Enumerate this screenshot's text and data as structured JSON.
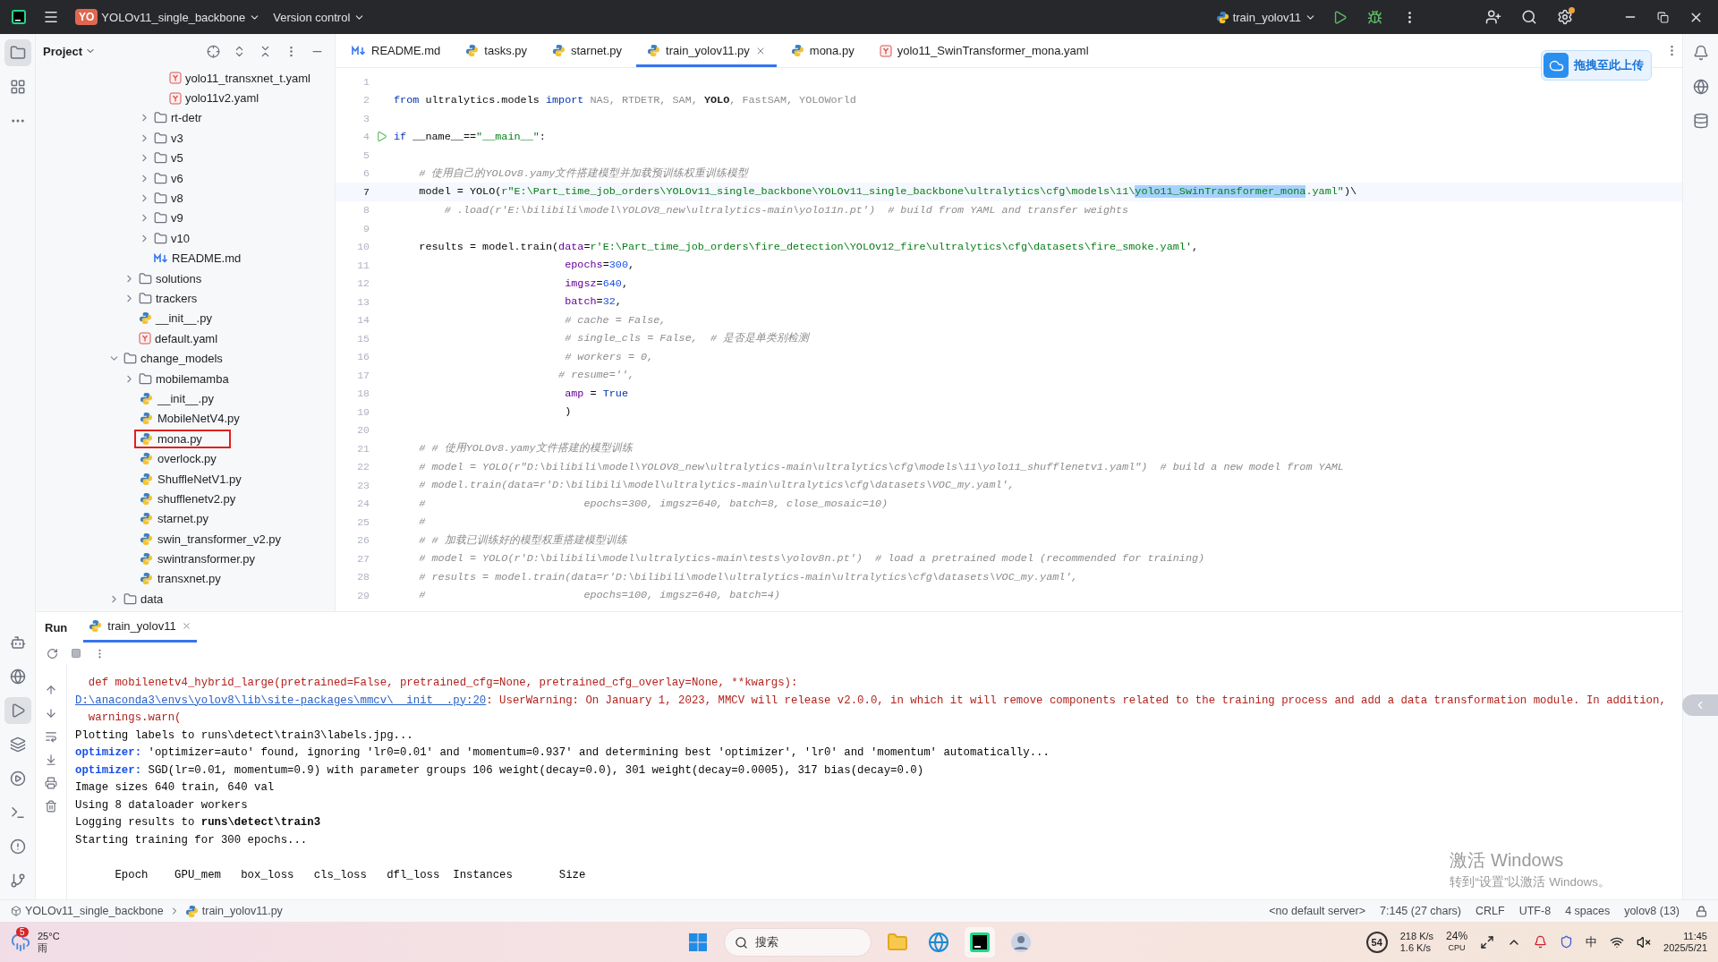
{
  "title_bar": {
    "project_badge": "YO",
    "project": "YOLOv11_single_backbone",
    "vcs": "Version control",
    "run_config": "train_yolov11"
  },
  "project": {
    "title": "Project",
    "tree": [
      {
        "children": [
          {
            "children": [
              {
                "children": [
                  {
                    "label": "yolo11_transxnet_t.yaml",
                    "kind": "yaml"
                  },
                  {
                    "label": "yolo11v2.yaml",
                    "kind": "yaml"
                  }
                ]
              },
              {
                "label": "rt-detr",
                "kind": "folder",
                "expanded": false
              },
              {
                "label": "v3",
                "kind": "folder",
                "expanded": false
              },
              {
                "label": "v5",
                "kind": "folder",
                "expanded": false
              },
              {
                "label": "v6",
                "kind": "folder",
                "expanded": false
              },
              {
                "label": "v8",
                "kind": "folder",
                "expanded": false
              },
              {
                "label": "v9",
                "kind": "folder",
                "expanded": false
              },
              {
                "label": "v10",
                "kind": "folder",
                "expanded": false
              },
              {
                "label": "README.md",
                "kind": "md"
              }
            ]
          },
          {
            "label": "solutions",
            "kind": "folder",
            "expanded": false
          },
          {
            "label": "trackers",
            "kind": "folder",
            "expanded": false
          },
          {
            "label": "__init__.py",
            "kind": "py"
          },
          {
            "label": "default.yaml",
            "kind": "yaml"
          }
        ]
      },
      {
        "label": "change_models",
        "kind": "folder",
        "expanded": true,
        "children": [
          {
            "label": "mobilemamba",
            "kind": "folder",
            "expanded": false
          },
          {
            "label": "__init__.py",
            "kind": "py",
            "annotated": false
          },
          {
            "label": "MobileNetV4.py",
            "kind": "py",
            "annotated": false
          },
          {
            "label": "mona.py",
            "kind": "py",
            "annotated": true
          },
          {
            "label": "overlock.py",
            "kind": "py",
            "annotated": false
          },
          {
            "label": "ShuffleNetV1.py",
            "kind": "py",
            "annotated": false
          },
          {
            "label": "shufflenetv2.py",
            "kind": "py",
            "annotated": false
          },
          {
            "label": "starnet.py",
            "kind": "py",
            "annotated": false
          },
          {
            "label": "swin_transformer_v2.py",
            "kind": "py",
            "annotated": false
          },
          {
            "label": "swintransformer.py",
            "kind": "py",
            "annotated": false
          },
          {
            "label": "transxnet.py",
            "kind": "py",
            "annotated": false
          }
        ]
      },
      {
        "label": "data",
        "kind": "folder",
        "expanded": false
      }
    ]
  },
  "editor_tabs": [
    {
      "label": "README.md",
      "kind": "md",
      "selected": false
    },
    {
      "label": "tasks.py",
      "kind": "py",
      "selected": false
    },
    {
      "label": "starnet.py",
      "kind": "py",
      "selected": false
    },
    {
      "label": "train_yolov11.py",
      "kind": "py",
      "selected": true
    },
    {
      "label": "mona.py",
      "kind": "py",
      "selected": false
    },
    {
      "label": "yolo11_SwinTransformer_mona.yaml",
      "kind": "yaml",
      "selected": false
    }
  ],
  "upload_widget": {
    "label": "拖拽至此上传"
  },
  "code": [
    {
      "n": "1",
      "current": false
    },
    {
      "n": "2",
      "current": false,
      "segments": [
        {
          "kind": "kw",
          "text": "from"
        },
        {
          "kind": "plain",
          "text": " ultralytics.models "
        },
        {
          "kind": "kw",
          "text": "import"
        },
        {
          "kind": "dim",
          "text": " NAS, RTDETR, SAM, "
        },
        {
          "kind": "bold",
          "text": "YOLO"
        },
        {
          "kind": "dim",
          "text": ", FastSAM, YOLOWorld"
        }
      ]
    },
    {
      "n": "3",
      "current": false
    },
    {
      "n": "4",
      "current": false,
      "run_marker": true,
      "segments": [
        {
          "kind": "kw",
          "text": "if"
        },
        {
          "kind": "plain",
          "text": " __name__=="
        },
        {
          "kind": "str",
          "text": "\"__main__\""
        },
        {
          "kind": "plain",
          "text": ":"
        }
      ]
    },
    {
      "n": "5",
      "current": false
    },
    {
      "n": "6",
      "current": false,
      "segments": [
        {
          "kind": "comment",
          "text": "    # 使用自己的YOLOv8.yamy文件搭建模型并加载预训练权重训练模型"
        }
      ]
    },
    {
      "n": "7",
      "current": true,
      "segments": [
        {
          "kind": "plain",
          "text": "    model = YOLO("
        },
        {
          "kind": "str",
          "text": "r\"E:\\Part_time_job_orders\\YOLOv11_single_backbone\\YOLOv11_single_backbone\\ultralytics\\cfg\\models\\11\\"
        },
        {
          "kind": "sel",
          "text": "yolo11_SwinTransformer_mona"
        },
        {
          "kind": "str",
          "text": ".yaml\""
        },
        {
          "kind": "plain",
          "text": ")\\"
        }
      ]
    },
    {
      "n": "8",
      "current": false,
      "segments": [
        {
          "kind": "comment",
          "text": "        # .load(r'E:\\bilibili\\model\\YOLOV8_new\\ultralytics-main\\yolo11n.pt')  # build from YAML and transfer weights"
        }
      ]
    },
    {
      "n": "9",
      "current": false
    },
    {
      "n": "10",
      "current": false,
      "segments": [
        {
          "kind": "plain",
          "text": "    results = model.train("
        },
        {
          "kind": "param",
          "text": "data"
        },
        {
          "kind": "plain",
          "text": "="
        },
        {
          "kind": "str",
          "text": "r'E:\\Part_time_job_orders\\fire_detection\\YOLOv12_fire\\ultralytics\\cfg\\datasets\\fire_smoke.yaml'"
        },
        {
          "kind": "plain",
          "text": ","
        }
      ]
    },
    {
      "n": "11",
      "current": false,
      "segments": [
        {
          "kind": "param",
          "text": "                           epochs"
        },
        {
          "kind": "plain",
          "text": "="
        },
        {
          "kind": "num",
          "text": "300"
        },
        {
          "kind": "plain",
          "text": ","
        }
      ]
    },
    {
      "n": "12",
      "current": false,
      "segments": [
        {
          "kind": "param",
          "text": "                           imgsz"
        },
        {
          "kind": "plain",
          "text": "="
        },
        {
          "kind": "num",
          "text": "640"
        },
        {
          "kind": "plain",
          "text": ","
        }
      ]
    },
    {
      "n": "13",
      "current": false,
      "segments": [
        {
          "kind": "param",
          "text": "                           batch"
        },
        {
          "kind": "plain",
          "text": "="
        },
        {
          "kind": "num",
          "text": "32"
        },
        {
          "kind": "plain",
          "text": ","
        }
      ]
    },
    {
      "n": "14",
      "current": false,
      "segments": [
        {
          "kind": "comment",
          "text": "                           # cache = False,"
        }
      ]
    },
    {
      "n": "15",
      "current": false,
      "segments": [
        {
          "kind": "comment",
          "text": "                           # single_cls = False,  # 是否是单类别检测"
        }
      ]
    },
    {
      "n": "16",
      "current": false,
      "segments": [
        {
          "kind": "comment",
          "text": "                           # workers = 0,"
        }
      ]
    },
    {
      "n": "17",
      "current": false,
      "segments": [
        {
          "kind": "comment",
          "text": "                          # resume='',"
        }
      ]
    },
    {
      "n": "18",
      "current": false,
      "segments": [
        {
          "kind": "param",
          "text": "                           amp"
        },
        {
          "kind": "plain",
          "text": " = "
        },
        {
          "kind": "kw",
          "text": "True"
        }
      ]
    },
    {
      "n": "19",
      "current": false,
      "segments": [
        {
          "kind": "plain",
          "text": "                           )"
        }
      ]
    },
    {
      "n": "20",
      "current": false
    },
    {
      "n": "21",
      "current": false,
      "segments": [
        {
          "kind": "comment",
          "text": "    # # 使用YOLOv8.yamy文件搭建的模型训练"
        }
      ]
    },
    {
      "n": "22",
      "current": false,
      "segments": [
        {
          "kind": "comment",
          "text": "    # model = YOLO(r\"D:\\bilibili\\model\\YOLOV8_new\\ultralytics-main\\ultralytics\\cfg\\models\\11\\yolo11_shufflenetv1.yaml\")  # build a new model from YAML"
        }
      ]
    },
    {
      "n": "23",
      "current": false,
      "segments": [
        {
          "kind": "comment",
          "text": "    # model.train(data=r'D:\\bilibili\\model\\ultralytics-main\\ultralytics\\cfg\\datasets\\VOC_my.yaml',"
        }
      ]
    },
    {
      "n": "24",
      "current": false,
      "segments": [
        {
          "kind": "comment",
          "text": "    #                         epochs=300, imgsz=640, batch=8, close_mosaic=10)"
        }
      ]
    },
    {
      "n": "25",
      "current": false,
      "segments": [
        {
          "kind": "comment",
          "text": "    #"
        }
      ]
    },
    {
      "n": "26",
      "current": false,
      "segments": [
        {
          "kind": "comment",
          "text": "    # # 加载已训练好的模型权重搭建模型训练"
        }
      ]
    },
    {
      "n": "27",
      "current": false,
      "segments": [
        {
          "kind": "comment",
          "text": "    # model = YOLO(r'D:\\bilibili\\model\\ultralytics-main\\tests\\yolov8n.pt')  # load a pretrained model (recommended for training)"
        }
      ]
    },
    {
      "n": "28",
      "current": false,
      "segments": [
        {
          "kind": "comment",
          "text": "    # results = model.train(data=r'D:\\bilibili\\model\\ultralytics-main\\ultralytics\\cfg\\datasets\\VOC_my.yaml',"
        }
      ]
    },
    {
      "n": "29",
      "current": false,
      "segments": [
        {
          "kind": "comment",
          "text": "    #                         epochs=100, imgsz=640, batch=4)"
        }
      ]
    }
  ],
  "run_panel": {
    "title": "Run",
    "tabs": [
      {
        "label": "train_yolov11",
        "selected": true
      }
    ],
    "console": [
      [
        {
          "kind": "error",
          "text": "  def mobilenetv4_hybrid_large(pretrained=False, pretrained_cfg=None, pretrained_cfg_overlay=None, **kwargs):"
        }
      ],
      [
        {
          "kind": "link",
          "text": "D:\\anaconda3\\envs\\yolov8\\lib\\site-packages\\mmcv\\__init__.py:20"
        },
        {
          "kind": "error",
          "text": ": UserWarning: On January 1, 2023, MMCV will release v2.0.0, in which it will remove components related to the training process and add a data transformation module. In addition,"
        }
      ],
      [
        {
          "kind": "error",
          "text": "  warnings.warn("
        }
      ],
      [
        {
          "kind": "text",
          "text": "Plotting labels to runs\\detect\\train3\\labels.jpg... "
        }
      ],
      [
        {
          "kind": "label",
          "text": "optimizer:"
        },
        {
          "kind": "text",
          "text": " 'optimizer=auto' found, ignoring 'lr0=0.01' and 'momentum=0.937' and determining best 'optimizer', 'lr0' and 'momentum' automatically... "
        }
      ],
      [
        {
          "kind": "label",
          "text": "optimizer:"
        },
        {
          "kind": "text",
          "text": " SGD(lr=0.01, momentum=0.9) with parameter groups 106 weight(decay=0.0), 301 weight(decay=0.0005), 317 bias(decay=0.0)"
        }
      ],
      [
        {
          "kind": "text",
          "text": "Image sizes 640 train, 640 val"
        }
      ],
      [
        {
          "kind": "text",
          "text": "Using 8 dataloader workers"
        }
      ],
      [
        {
          "kind": "text",
          "text": "Logging results to "
        },
        {
          "kind": "bold",
          "text": "runs\\detect\\train3"
        }
      ],
      [
        {
          "kind": "text",
          "text": "Starting training for 300 epochs..."
        }
      ],
      [
        {
          "kind": "text",
          "text": "      Epoch    GPU_mem   box_loss   cls_loss   dfl_loss  Instances       Size"
        }
      ]
    ]
  },
  "activation": {
    "title": "激活 Windows",
    "hint": "转到“设置”以激活 Windows。"
  },
  "status_bar": {
    "breadcrumbs": [
      {
        "label": "YOLOv11_single_backbone",
        "kind": "module"
      },
      {
        "label": "train_yolov11.py",
        "kind": "py"
      }
    ],
    "items": [
      "<no default server>",
      "7:145 (27 chars)",
      "CRLF",
      "UTF-8",
      "4 spaces",
      "yolov8 (13)"
    ]
  },
  "taskbar": {
    "weather": {
      "badge": "5",
      "temperature": "25°C",
      "condition": "雨"
    },
    "search": {
      "placeholder": "搜索"
    },
    "tray": {
      "score": "54",
      "upload": "218 K/s",
      "download": "1.6 K/s",
      "cpu": "24%",
      "cpu_label": "CPU",
      "ime": "中",
      "time": "11:45",
      "date": "2025/5/21"
    }
  }
}
